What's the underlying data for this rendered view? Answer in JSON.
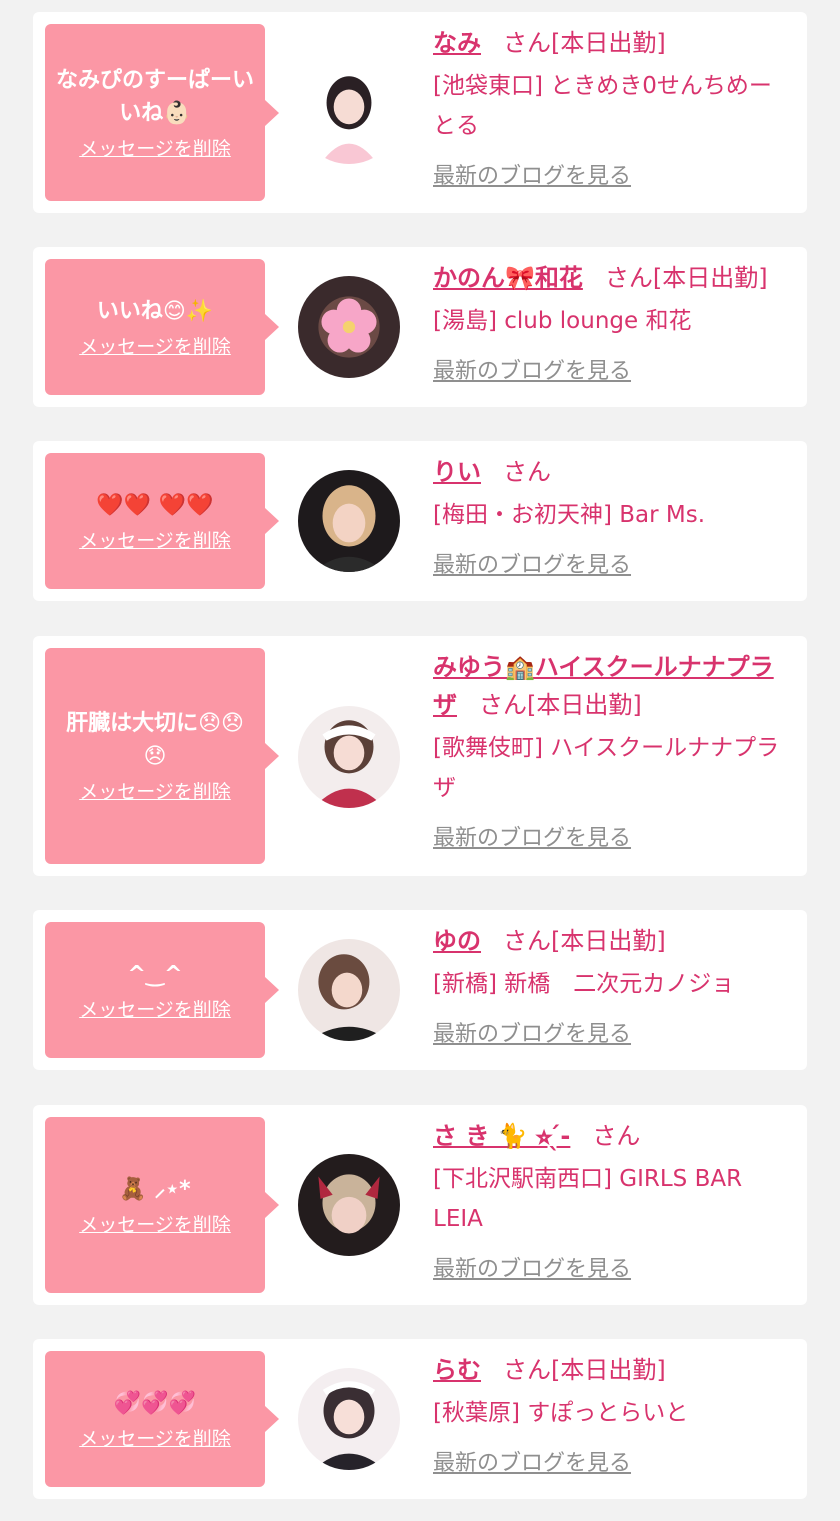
{
  "delete_label": "メッセージを削除",
  "blog_label": "最新のブログを見る",
  "suffix": "さん",
  "accent_color": "#fb97a5",
  "name_color": "#d8336d",
  "cards": [
    {
      "message": "なみぴのすーぱーいいね👶🏻",
      "name": "なみ",
      "status": "[本日出勤]",
      "shop": "[池袋東口] ときめき0せんちめーとる"
    },
    {
      "message": "いいね😊✨",
      "name": "かのん🎀和花",
      "status": "[本日出勤]",
      "shop": "[湯島] club lounge 和花"
    },
    {
      "message": "❤️❤️ ❤️❤️",
      "name": "りい",
      "status": "",
      "shop": "[梅田・お初天神] Bar Ms."
    },
    {
      "message": "肝臓は大切に😞😞😞",
      "name": "みゆう🏫ハイスクールナナプラザ",
      "status": "[本日出勤]",
      "shop": "[歌舞伎町] ハイスクールナナプラザ"
    },
    {
      "message": "^‿^",
      "name": "ゆの",
      "status": "[本日出勤]",
      "shop": "[新橋] 新橋　二次元カノジョ"
    },
    {
      "message": "🧸 ⸝⋆*",
      "name": "さ き 🐈 ⭐︎ ̖́-",
      "status": "",
      "shop": "[下北沢駅南西口] GIRLS BAR LEIA"
    },
    {
      "message": "💞💞💞",
      "name": "らむ",
      "status": "[本日出勤]",
      "shop": "[秋葉原] すぽっとらいと"
    }
  ]
}
